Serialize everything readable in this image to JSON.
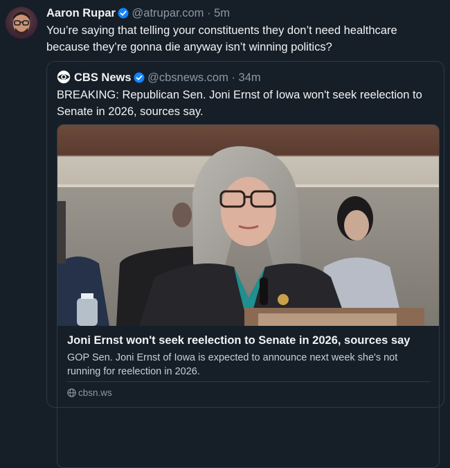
{
  "post": {
    "author_name": "Aaron Rupar",
    "handle": "@atrupar.com",
    "separator": "·",
    "time": "5m",
    "text": "You’re saying that telling your constituents they don’t need healthcare because they’re gonna die anyway isn’t winning politics?"
  },
  "quote": {
    "author_name": "CBS News",
    "handle": "@cbsnews.com",
    "separator": "·",
    "time": "34m",
    "text": "BREAKING: Republican Sen. Joni Ernst of Iowa won't seek reelection to Senate in 2026, sources say.",
    "card": {
      "title": "Joni Ernst won't seek reelection to Senate in 2026, sources say",
      "description": "GOP Sen. Joni Ernst of Iowa is expected to announce next week she's not running for reelection in 2026.",
      "domain": "cbsn.ws",
      "globe_icon": "globe-icon"
    }
  },
  "colors": {
    "background": "#161e27",
    "border": "#2f3a46",
    "muted": "#8b98a5",
    "verified": "#1185fe"
  }
}
